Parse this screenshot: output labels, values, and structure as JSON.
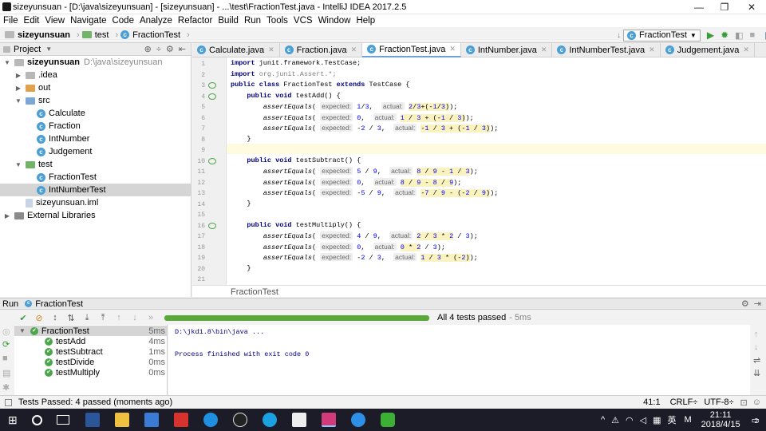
{
  "window": {
    "title": "sizeyunsuan - [D:\\java\\sizeyunsuan] - [sizeyunsuan] - ...\\test\\FractionTest.java - IntelliJ IDEA 2017.2.5",
    "min": "—",
    "max": "❐",
    "close": "✕"
  },
  "menu": [
    "File",
    "Edit",
    "View",
    "Navigate",
    "Code",
    "Analyze",
    "Refactor",
    "Build",
    "Run",
    "Tools",
    "VCS",
    "Window",
    "Help"
  ],
  "nav": {
    "crumbs": [
      "sizeyunsuan",
      "test",
      "FractionTest"
    ],
    "run_config": "FractionTest"
  },
  "project": {
    "header": "Project",
    "tree": [
      {
        "label": "sizeyunsuan",
        "note": "D:\\java\\sizeyunsuan",
        "indent": 0,
        "icon": "folder",
        "arrow": "▼"
      },
      {
        "label": ".idea",
        "indent": 1,
        "icon": "folder",
        "arrow": "▶"
      },
      {
        "label": "out",
        "indent": 1,
        "icon": "folder-orange",
        "arrow": "▶"
      },
      {
        "label": "src",
        "indent": 1,
        "icon": "folder-blue",
        "arrow": "▼"
      },
      {
        "label": "Calculate",
        "indent": 2,
        "icon": "class"
      },
      {
        "label": "Fraction",
        "indent": 2,
        "icon": "class"
      },
      {
        "label": "IntNumber",
        "indent": 2,
        "icon": "class"
      },
      {
        "label": "Judgement",
        "indent": 2,
        "icon": "class"
      },
      {
        "label": "test",
        "indent": 1,
        "icon": "folder-green",
        "arrow": "▼"
      },
      {
        "label": "FractionTest",
        "indent": 2,
        "icon": "class"
      },
      {
        "label": "IntNumberTest",
        "indent": 2,
        "icon": "class",
        "selected": true
      },
      {
        "label": "sizeyunsuan.iml",
        "indent": 1,
        "icon": "file"
      },
      {
        "label": "External Libraries",
        "indent": 0,
        "icon": "lib",
        "arrow": "▶"
      }
    ]
  },
  "tabs": [
    {
      "label": "Calculate.java"
    },
    {
      "label": "Fraction.java"
    },
    {
      "label": "FractionTest.java",
      "active": true
    },
    {
      "label": "IntNumber.java"
    },
    {
      "label": "IntNumberTest.java"
    },
    {
      "label": "Judgement.java"
    }
  ],
  "editor": {
    "breadcrumb": "FractionTest",
    "lines": [
      "1",
      "2",
      "3",
      "4",
      "5",
      "6",
      "7",
      "8",
      "9",
      "10",
      "11",
      "12",
      "13",
      "14",
      "15",
      "16",
      "17",
      "18",
      "19",
      "20",
      "21"
    ]
  },
  "run": {
    "header": "Run",
    "config": "FractionTest",
    "summary": "All 4 tests passed",
    "time": "- 5ms",
    "tests": [
      {
        "name": "FractionTest",
        "time": "5ms"
      },
      {
        "name": "testAdd",
        "time": "4ms"
      },
      {
        "name": "testSubtract",
        "time": "1ms"
      },
      {
        "name": "testDivide",
        "time": "0ms"
      },
      {
        "name": "testMultiply",
        "time": "0ms"
      }
    ],
    "console": [
      "D:\\jkd1.8\\bin\\java ...",
      "Process finished with exit code 0"
    ]
  },
  "status": {
    "message": "Tests Passed: 4 passed (moments ago)",
    "pos": "41:1",
    "crlf": "CRLF÷",
    "enc": "UTF-8÷"
  },
  "taskbar": {
    "time": "21:11",
    "date": "2018/4/15",
    "lang": "英",
    "ime": "M",
    "notif": "2"
  }
}
